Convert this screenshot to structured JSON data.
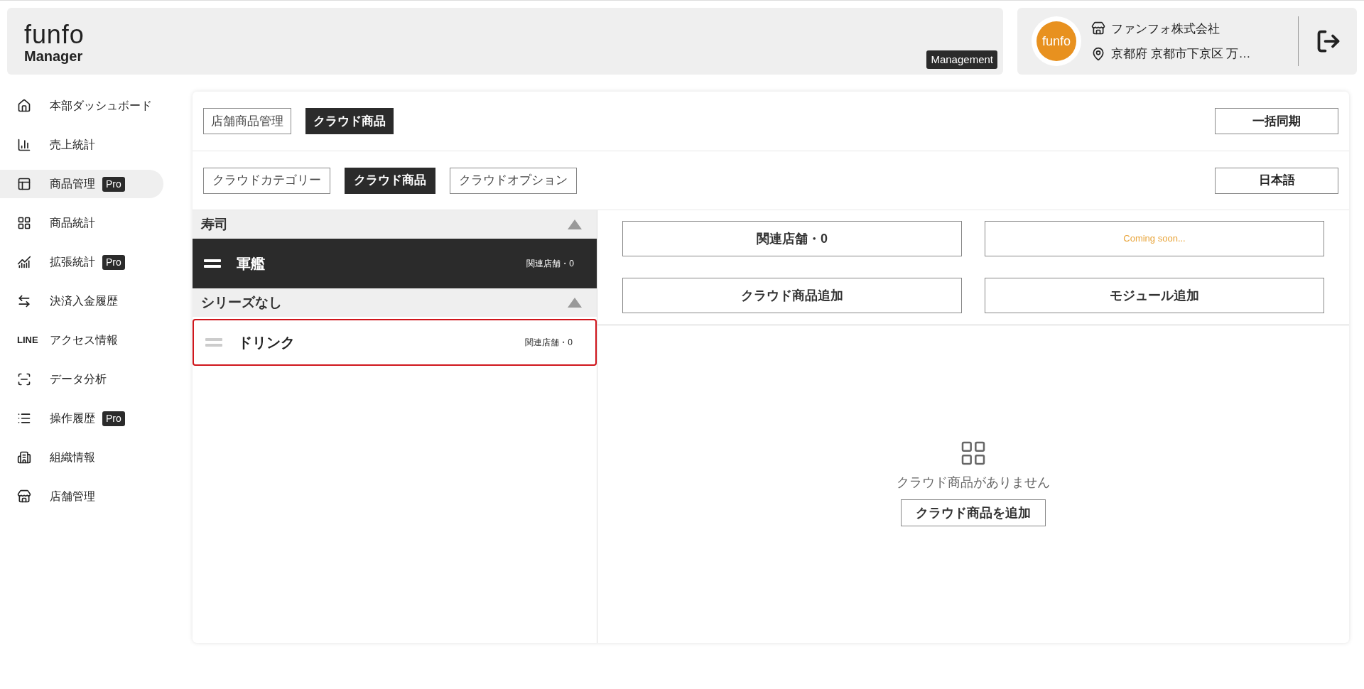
{
  "header": {
    "logo_top": "funfo",
    "logo_bottom": "Manager",
    "mode_badge": "Management",
    "avatar_text": "funfo",
    "company": "ファンフォ株式会社",
    "address": "京都府 京都市下京区 万…"
  },
  "sidebar": {
    "items": [
      {
        "label": "本部ダッシュボード",
        "selected": false
      },
      {
        "label": "売上統計",
        "selected": false
      },
      {
        "label": "商品管理",
        "selected": true,
        "badge": "Pro"
      },
      {
        "label": "商品統計",
        "selected": false
      },
      {
        "label": "拡張統計",
        "selected": false,
        "badge": "Pro"
      },
      {
        "label": "決済入金履歴",
        "selected": false
      },
      {
        "label": "アクセス情報",
        "selected": false,
        "logo_text": "LINE"
      },
      {
        "label": "データ分析",
        "selected": false
      },
      {
        "label": "操作履歴",
        "selected": false,
        "badge": "Pro"
      },
      {
        "label": "組織情報",
        "selected": false
      },
      {
        "label": "店舗管理",
        "selected": false
      }
    ]
  },
  "top_tabs": [
    {
      "label": "店舗商品管理",
      "selected": false
    },
    {
      "label": "クラウド商品",
      "selected": true
    }
  ],
  "sync_button": "一括同期",
  "sub_tabs": [
    {
      "label": "クラウドカテゴリー",
      "selected": false
    },
    {
      "label": "クラウド商品",
      "selected": true
    },
    {
      "label": "クラウドオプション",
      "selected": false
    }
  ],
  "language_button": "日本語",
  "groups": [
    {
      "title": "寿司",
      "expanded": true,
      "items": [
        {
          "name": "軍艦",
          "stores": "関連店舗・0",
          "selected": true,
          "focused": false
        }
      ]
    },
    {
      "title": "シリーズなし",
      "expanded": true,
      "items": [
        {
          "name": "ドリンク",
          "stores": "関連店舗・0",
          "selected": false,
          "focused": true
        }
      ]
    }
  ],
  "actions": [
    {
      "label": "関連店舗・0",
      "kind": "normal"
    },
    {
      "label": "Coming soon...",
      "kind": "soon"
    },
    {
      "label": "クラウド商品追加",
      "kind": "normal"
    },
    {
      "label": "モジュール追加",
      "kind": "normal"
    }
  ],
  "empty_state": {
    "message": "クラウド商品がありません",
    "button": "クラウド商品を追加"
  }
}
